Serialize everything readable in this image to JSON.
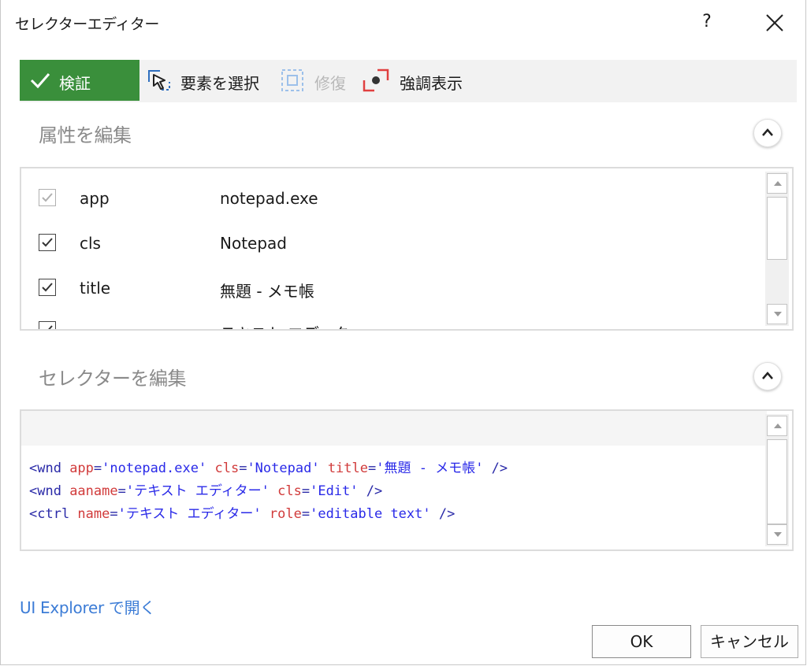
{
  "window": {
    "title": "セレクターエディター",
    "help_label": "?"
  },
  "toolbar": {
    "validate_label": "検証",
    "select_label": "要素を選択",
    "repair_label": "修復",
    "highlight_label": "強調表示"
  },
  "attributes_section": {
    "title": "属性を編集",
    "rows": [
      {
        "name": "app",
        "value": "notepad.exe",
        "checked": true,
        "disabled": true
      },
      {
        "name": "cls",
        "value": "Notepad",
        "checked": true,
        "disabled": false
      },
      {
        "name": "title",
        "value": "無題 - メモ帳",
        "checked": true,
        "disabled": false
      },
      {
        "name": "",
        "value": "テキスト エディタ",
        "checked": true,
        "disabled": false
      }
    ]
  },
  "selector_section": {
    "title": "セレクターを編集",
    "lines": [
      [
        [
          "tag",
          "<wnd "
        ],
        [
          "an",
          "app"
        ],
        [
          "tag",
          "="
        ],
        [
          "av",
          "'notepad.exe'"
        ],
        [
          "tag",
          " "
        ],
        [
          "an",
          "cls"
        ],
        [
          "tag",
          "="
        ],
        [
          "av",
          "'Notepad'"
        ],
        [
          "tag",
          " "
        ],
        [
          "an",
          "title"
        ],
        [
          "tag",
          "="
        ],
        [
          "av",
          "'無題 - メモ帳'"
        ],
        [
          "tag",
          " />"
        ]
      ],
      [
        [
          "tag",
          "<wnd "
        ],
        [
          "an",
          "aaname"
        ],
        [
          "tag",
          "="
        ],
        [
          "av",
          "'テキスト エディター'"
        ],
        [
          "tag",
          " "
        ],
        [
          "an",
          "cls"
        ],
        [
          "tag",
          "="
        ],
        [
          "av",
          "'Edit'"
        ],
        [
          "tag",
          " />"
        ]
      ],
      [
        [
          "tag",
          "<ctrl "
        ],
        [
          "an",
          "name"
        ],
        [
          "tag",
          "="
        ],
        [
          "av",
          "'テキスト エディター'"
        ],
        [
          "tag",
          " "
        ],
        [
          "an",
          "role"
        ],
        [
          "tag",
          "="
        ],
        [
          "av",
          "'editable text'"
        ],
        [
          "tag",
          " />"
        ]
      ]
    ]
  },
  "footer": {
    "explorer_link": "UI Explorer で開く",
    "ok_label": "OK",
    "cancel_label": "キャンセル"
  },
  "colors": {
    "validate_bg": "#3a8f3b",
    "link": "#3c7cd6",
    "code_tag": "#2a2aa8",
    "code_attr_name": "#d13b3b",
    "code_attr_value": "#2a2ae8"
  },
  "icons": [
    "check-icon",
    "cursor-select-icon",
    "repair-icon",
    "highlight-icon",
    "close-icon",
    "chevron-up-icon",
    "checkbox-check-icon",
    "scroll-up-icon",
    "scroll-down-icon"
  ]
}
